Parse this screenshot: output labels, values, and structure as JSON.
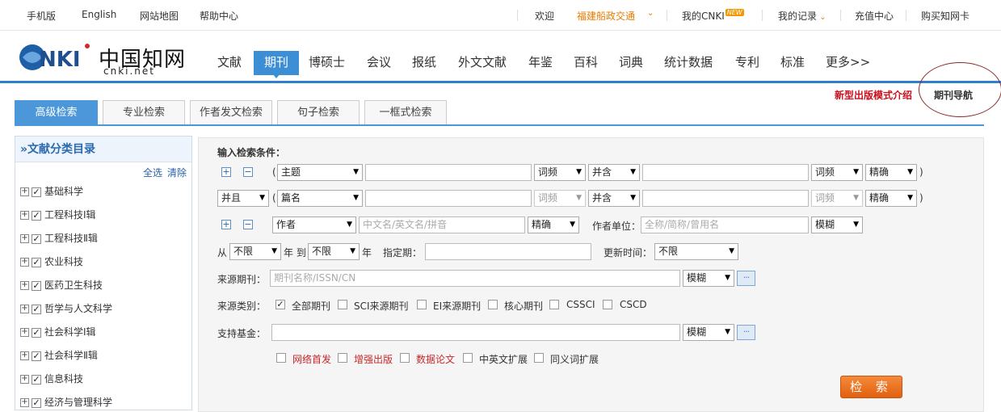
{
  "topbar": {
    "mobile": "手机版",
    "english": "English",
    "sitemap": "网站地图",
    "help": "帮助中心",
    "welcome": "欢迎",
    "org": "福建船政交通",
    "mycnki": "我的CNKI",
    "new_badge": "NEW",
    "records": "我的记录",
    "recharge": "充值中心",
    "buycard": "购买知网卡"
  },
  "logo": {
    "text": "中国知网",
    "domain": "cnki.net"
  },
  "nav": [
    "文献",
    "期刊",
    "博硕士",
    "会议",
    "报纸",
    "外文文献",
    "年鉴",
    "百科",
    "词典",
    "统计数据",
    "专利",
    "标准",
    "更多>>"
  ],
  "nav_active": "期刊",
  "promo": {
    "new_mode": "新型出版模式介绍",
    "journal_nav": "期刊导航"
  },
  "tabs": [
    "高级检索",
    "专业检索",
    "作者发文检索",
    "句子检索",
    "一框式检索"
  ],
  "sidebar": {
    "title": "»文献分类目录",
    "select_all": "全选",
    "clear": "清除",
    "items": [
      "基础科学",
      "工程科技Ⅰ辑",
      "工程科技Ⅱ辑",
      "农业科技",
      "医药卫生科技",
      "哲学与人文科学",
      "社会科学Ⅰ辑",
      "社会科学Ⅱ辑",
      "信息科技",
      "经济与管理科学"
    ]
  },
  "form": {
    "title": "输入检索条件：",
    "row1": {
      "field": "主题",
      "freq1": "词频",
      "combine": "并含",
      "freq2": "词频",
      "match": "精确"
    },
    "row2": {
      "logic": "并且",
      "field": "篇名",
      "freq1": "词频",
      "combine": "并含",
      "freq2": "词频",
      "match": "精确"
    },
    "row3": {
      "field": "作者",
      "name_placeholder": "中文名/英文名/拼音",
      "match": "精确",
      "unit_label": "作者单位：",
      "unit_placeholder": "全称/简称/曾用名",
      "unit_match": "模糊"
    },
    "row4": {
      "from": "从",
      "from_val": "不限",
      "year_to": "年 到",
      "to_val": "不限",
      "year": "年",
      "period_label": "指定期：",
      "update_label": "更新时间：",
      "update_val": "不限"
    },
    "source": {
      "label": "来源期刊：",
      "placeholder": "期刊名称/ISSN/CN",
      "match": "模糊",
      "more": "···"
    },
    "category": {
      "label": "来源类别：",
      "options": [
        "全部期刊",
        "SCI来源期刊",
        "EI来源期刊",
        "核心期刊",
        "CSSCI",
        "CSCD"
      ]
    },
    "fund": {
      "label": "支持基金：",
      "match": "模糊",
      "more": "···"
    },
    "extras": [
      "网络首发",
      "增强出版",
      "数据论文",
      "中英文扩展",
      "同义词扩展"
    ],
    "search_button": "检 索",
    "paren_open": "(",
    "paren_close": ")",
    "plus": "+",
    "minus": "−"
  }
}
